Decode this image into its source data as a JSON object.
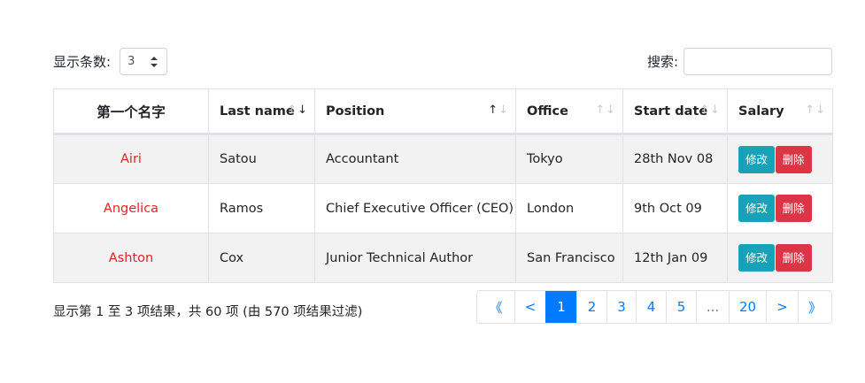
{
  "length_menu": {
    "label": "显示条数:",
    "selected": "3"
  },
  "search": {
    "label": "搜索:",
    "value": "",
    "placeholder": ""
  },
  "table": {
    "headers": [
      "第一个名字",
      "Last name",
      "Position",
      "Office",
      "Start date",
      "Salary"
    ],
    "rows": [
      {
        "first": "Airi",
        "last": "Satou",
        "position": "Accountant",
        "office": "Tokyo",
        "start": "28th Nov 08"
      },
      {
        "first": "Angelica",
        "last": "Ramos",
        "position": "Chief Executive Officer (CEO)",
        "office": "London",
        "start": "9th Oct 09"
      },
      {
        "first": "Ashton",
        "last": "Cox",
        "position": "Junior Technical Author",
        "office": "San Francisco",
        "start": "12th Jan 09"
      }
    ],
    "edit_label": "修改",
    "delete_label": "删除"
  },
  "info": "显示第 1 至 3 项结果，共 60 项 (由 570 项结果过滤)",
  "pagination": {
    "first": "《",
    "prev": "<",
    "pages": [
      "1",
      "2",
      "3",
      "4",
      "5"
    ],
    "ellipsis": "...",
    "last_page": "20",
    "next": ">",
    "last": "》",
    "active": "1"
  },
  "colors": {
    "primary": "#007bff",
    "edit": "#17a2b8",
    "delete": "#dc3545",
    "link_red": "#e02424",
    "stripe": "#f2f2f2"
  }
}
